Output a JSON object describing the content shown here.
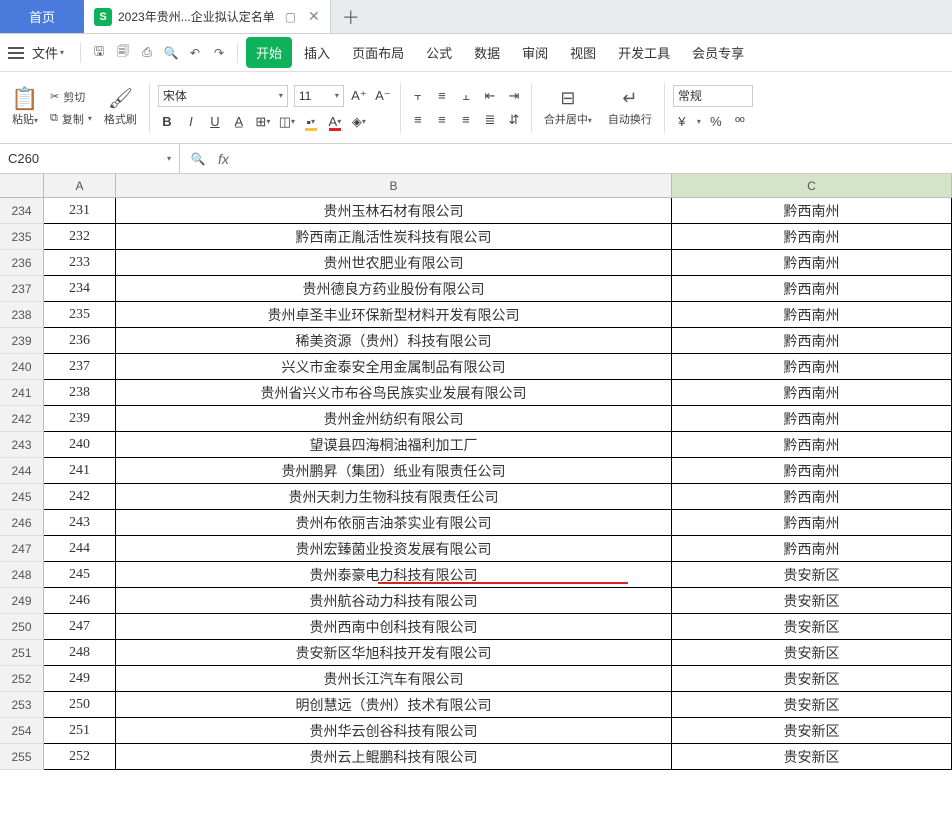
{
  "tabs": {
    "home": "首页",
    "file_label": "2023年贵州...企业拟认定名单",
    "file_icon_letter": "S"
  },
  "menu": {
    "file": "文件",
    "items": [
      "开始",
      "插入",
      "页面布局",
      "公式",
      "数据",
      "审阅",
      "视图",
      "开发工具",
      "会员专享"
    ]
  },
  "ribbon": {
    "paste": "粘贴",
    "cut": "剪切",
    "copy": "复制",
    "format_painter": "格式刷",
    "font_name": "宋体",
    "font_size": "11",
    "bold": "B",
    "italic": "I",
    "underline": "U",
    "merge_center": "合并居中",
    "wrap_text": "自动换行",
    "number_format": "常规",
    "currency": "¥",
    "percent": "%"
  },
  "formula": {
    "name_box": "C260",
    "fx": "fx"
  },
  "grid": {
    "cols": [
      "A",
      "B",
      "C"
    ],
    "selected_col_index": 2,
    "selected_cell": "C260",
    "highlight_row_index": 14
  },
  "chart_data": {
    "type": "table",
    "columns": [
      "row_number",
      "序号",
      "公司名称_B",
      "地区_C"
    ],
    "rows": [
      {
        "row_number": 234,
        "序号": 231,
        "公司名称_B": "贵州玉林石材有限公司",
        "地区_C": "黔西南州"
      },
      {
        "row_number": 235,
        "序号": 232,
        "公司名称_B": "黔西南正胤活性炭科技有限公司",
        "地区_C": "黔西南州"
      },
      {
        "row_number": 236,
        "序号": 233,
        "公司名称_B": "贵州世农肥业有限公司",
        "地区_C": "黔西南州"
      },
      {
        "row_number": 237,
        "序号": 234,
        "公司名称_B": "贵州德良方药业股份有限公司",
        "地区_C": "黔西南州"
      },
      {
        "row_number": 238,
        "序号": 235,
        "公司名称_B": "贵州卓圣丰业环保新型材料开发有限公司",
        "地区_C": "黔西南州"
      },
      {
        "row_number": 239,
        "序号": 236,
        "公司名称_B": "稀美资源（贵州）科技有限公司",
        "地区_C": "黔西南州"
      },
      {
        "row_number": 240,
        "序号": 237,
        "公司名称_B": "兴义市金泰安全用金属制品有限公司",
        "地区_C": "黔西南州"
      },
      {
        "row_number": 241,
        "序号": 238,
        "公司名称_B": "贵州省兴义市布谷鸟民族实业发展有限公司",
        "地区_C": "黔西南州"
      },
      {
        "row_number": 242,
        "序号": 239,
        "公司名称_B": "贵州金州纺织有限公司",
        "地区_C": "黔西南州"
      },
      {
        "row_number": 243,
        "序号": 240,
        "公司名称_B": "望谟县四海桐油福利加工厂",
        "地区_C": "黔西南州"
      },
      {
        "row_number": 244,
        "序号": 241,
        "公司名称_B": "贵州鹏昇（集团）纸业有限责任公司",
        "地区_C": "黔西南州"
      },
      {
        "row_number": 245,
        "序号": 242,
        "公司名称_B": "贵州天刺力生物科技有限责任公司",
        "地区_C": "黔西南州"
      },
      {
        "row_number": 246,
        "序号": 243,
        "公司名称_B": "贵州布依丽吉油茶实业有限公司",
        "地区_C": "黔西南州"
      },
      {
        "row_number": 247,
        "序号": 244,
        "公司名称_B": "贵州宏臻菌业投资发展有限公司",
        "地区_C": "黔西南州"
      },
      {
        "row_number": 248,
        "序号": 245,
        "公司名称_B": "贵州泰豪电力科技有限公司",
        "地区_C": "贵安新区"
      },
      {
        "row_number": 249,
        "序号": 246,
        "公司名称_B": "贵州航谷动力科技有限公司",
        "地区_C": "贵安新区"
      },
      {
        "row_number": 250,
        "序号": 247,
        "公司名称_B": "贵州西南中创科技有限公司",
        "地区_C": "贵安新区"
      },
      {
        "row_number": 251,
        "序号": 248,
        "公司名称_B": "贵安新区华旭科技开发有限公司",
        "地区_C": "贵安新区"
      },
      {
        "row_number": 252,
        "序号": 249,
        "公司名称_B": "贵州长江汽车有限公司",
        "地区_C": "贵安新区"
      },
      {
        "row_number": 253,
        "序号": 250,
        "公司名称_B": "明创慧远（贵州）技术有限公司",
        "地区_C": "贵安新区"
      },
      {
        "row_number": 254,
        "序号": 251,
        "公司名称_B": "贵州华云创谷科技有限公司",
        "地区_C": "贵安新区"
      },
      {
        "row_number": 255,
        "序号": 252,
        "公司名称_B": "贵州云上鲲鹏科技有限公司",
        "地区_C": "贵安新区"
      }
    ]
  }
}
